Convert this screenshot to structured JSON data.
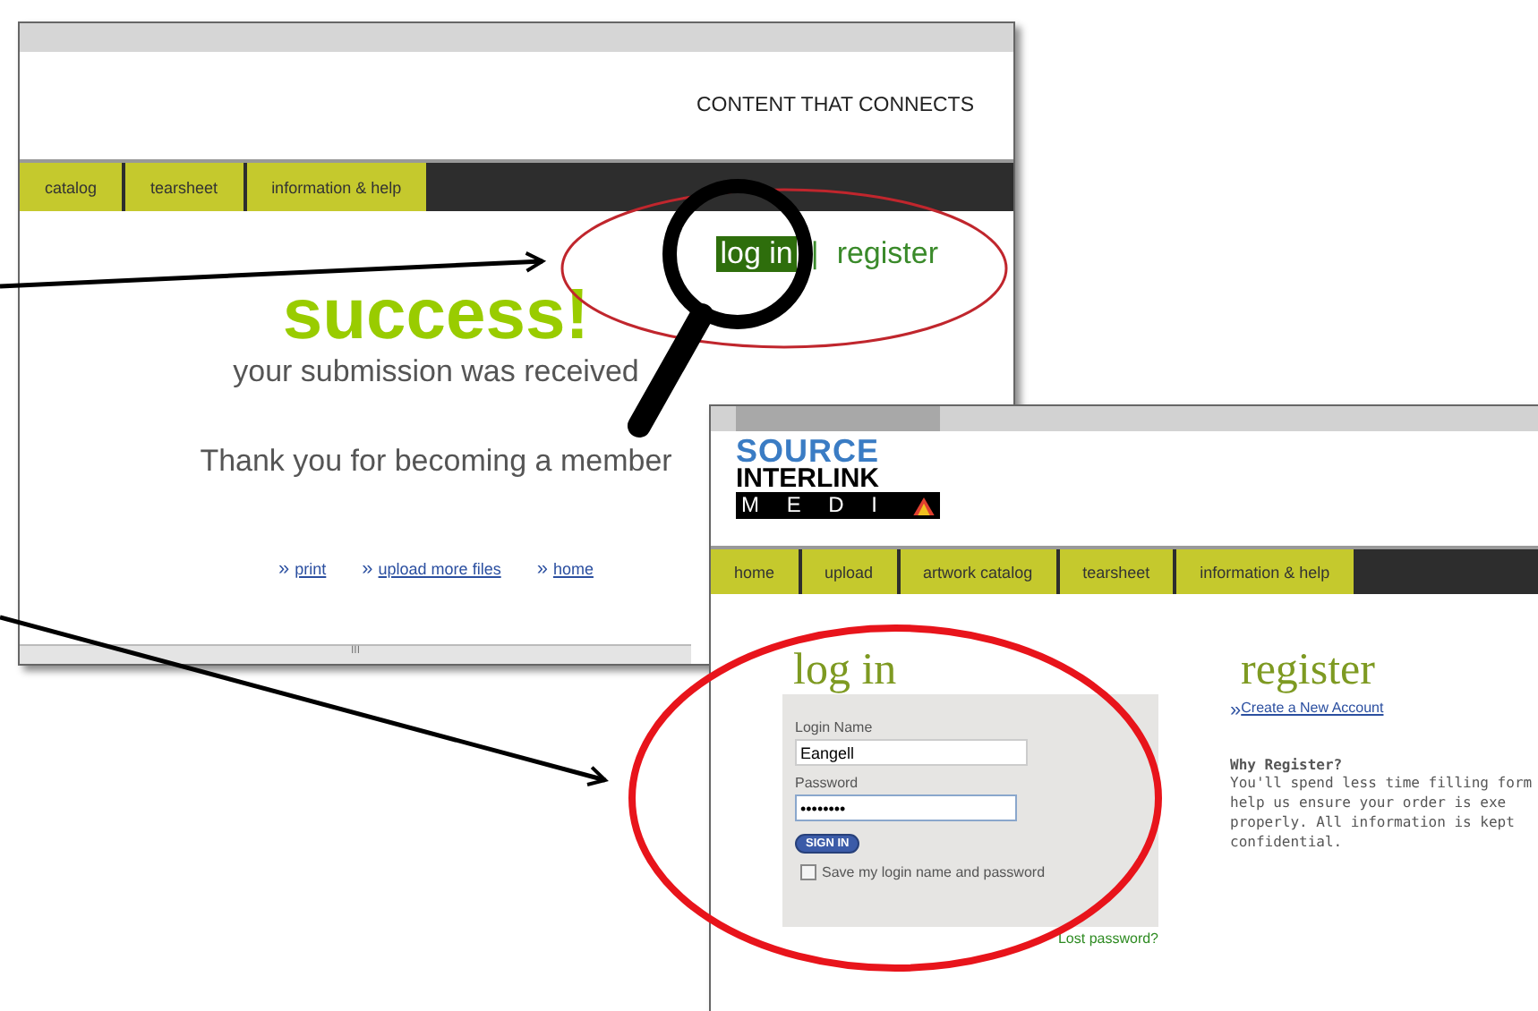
{
  "back_window": {
    "tagline": "CONTENT THAT CONNECTS",
    "tabs": [
      {
        "label": "catalog"
      },
      {
        "label": "tearsheet"
      },
      {
        "label": "information & help"
      }
    ],
    "account_links": [
      {
        "label": "log in",
        "selected": true
      },
      {
        "label": "register",
        "selected": false
      }
    ],
    "separator": "|",
    "heading": "success!",
    "subheading": "your submission was received",
    "message": "Thank you for becoming a member",
    "footer_links": [
      {
        "marker": "»",
        "label": "print"
      },
      {
        "marker": "»",
        "label": "upload more files"
      },
      {
        "marker": "»",
        "label": "home"
      }
    ],
    "scroll_grip": "III"
  },
  "front_window": {
    "logo": {
      "line_1": "SOURCE",
      "line_2": "INTERLINK",
      "line_3": "M E D I"
    },
    "tabs": [
      {
        "label": "home"
      },
      {
        "label": "upload"
      },
      {
        "label": "artwork catalog"
      },
      {
        "label": "tearsheet"
      },
      {
        "label": "information & help"
      }
    ],
    "login": {
      "title": "log in",
      "name_label": "Login Name",
      "name_value": "Eangell",
      "password_label": "Password",
      "password_value": "••••••••",
      "button": "SIGN IN",
      "remember": {
        "label": "Save my login name and password",
        "checked": false
      },
      "lost_link": "Lost password?"
    },
    "register": {
      "title": "register",
      "marker": "»",
      "link": "Create a New Account",
      "why_title": "Why Register?",
      "why_text": "You'll spend less time filling form\nhelp us ensure your order is exe\nproperly. All information is kept\nconfidential."
    }
  }
}
